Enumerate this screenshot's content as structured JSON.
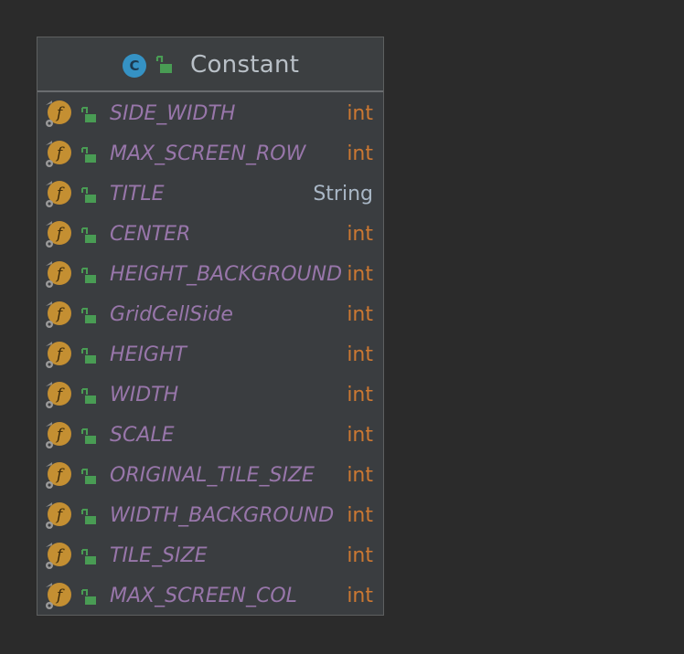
{
  "class": {
    "icon_letter": "C",
    "name": "Constant",
    "icon": "class-icon",
    "visibility_icon": "public-unlock-icon"
  },
  "fields": [
    {
      "name": "SIDE_WIDTH",
      "type": "int"
    },
    {
      "name": "MAX_SCREEN_ROW",
      "type": "int"
    },
    {
      "name": "TITLE",
      "type": "String"
    },
    {
      "name": "CENTER",
      "type": "int"
    },
    {
      "name": "HEIGHT_BACKGROUND",
      "type": "int"
    },
    {
      "name": "GridCellSide",
      "type": "int"
    },
    {
      "name": "HEIGHT",
      "type": "int"
    },
    {
      "name": "WIDTH",
      "type": "int"
    },
    {
      "name": "SCALE",
      "type": "int"
    },
    {
      "name": "ORIGINAL_TILE_SIZE",
      "type": "int"
    },
    {
      "name": "WIDTH_BACKGROUND",
      "type": "int"
    },
    {
      "name": "TILE_SIZE",
      "type": "int"
    },
    {
      "name": "MAX_SCREEN_COL",
      "type": "int"
    }
  ],
  "field_icon": {
    "letter": "f",
    "name": "static-final-field-icon"
  },
  "colors": {
    "background": "#2b2b2b",
    "box": "#3a3d40",
    "field_name": "#9876aa",
    "primitive_type": "#cc7832",
    "reference_type": "#a9b7c6",
    "class_icon": "#3592c4",
    "field_icon": "#c48f32",
    "lock": "#499c54"
  }
}
